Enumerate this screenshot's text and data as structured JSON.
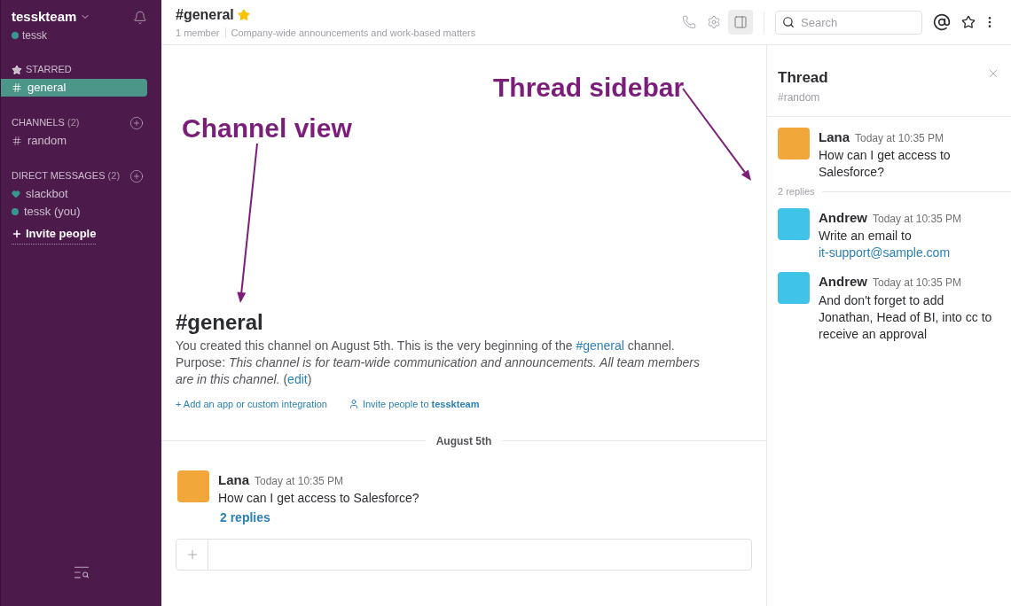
{
  "sidebar": {
    "team": "tesskteam",
    "user": "tessk",
    "starred": {
      "title": "STARRED",
      "items": [
        {
          "kind": "channel",
          "label": "general",
          "selected": true
        }
      ]
    },
    "channels": {
      "title": "CHANNELS",
      "count": "(2)",
      "items": [
        {
          "kind": "channel",
          "label": "random",
          "selected": false
        }
      ]
    },
    "direct_messages": {
      "title": "DIRECT MESSAGES",
      "count": "(2)",
      "items": [
        {
          "kind": "heart",
          "label": "slackbot",
          "selected": false
        },
        {
          "kind": "presence",
          "label": "tessk (you)",
          "selected": false
        }
      ]
    },
    "invite": "Invite people"
  },
  "header": {
    "channel": "#general",
    "starred": true,
    "members": "1 member",
    "topic": "Company-wide announcements and work-based matters",
    "details_toggle": {
      "selected": true
    },
    "search": {
      "placeholder": "Search"
    }
  },
  "channel": {
    "title": "#general",
    "intro_before": "You created this channel on August 5th. This is the very beginning of the ",
    "channel_link": "#general",
    "intro_after": " channel.",
    "purpose": "Purpose: *This channel is for team-wide communication and announcements. All team members are in this channel.* (",
    "edit_link": "edit",
    "purpose_close": ")",
    "add_app": "+ Add an app or custom integration",
    "invite": "Invite people to **tesskteam**",
    "divider": "August 5th",
    "messages": [
      {
        "author": "Lana",
        "color": "#f2a73b",
        "time": "Today at 10:35 PM",
        "text": "How can I get access to Salesforce?",
        "replies": "2 replies"
      }
    ]
  },
  "thread": {
    "title": "Thread",
    "channel": "#random",
    "parent": {
      "author": "Lana",
      "color": "#f2a73b",
      "time": "Today at 10:35 PM",
      "text": "How can I get access to Salesforce?"
    },
    "replies_label": "2 replies",
    "replies": [
      {
        "author": "Andrew",
        "color": "#3fc3e8",
        "time": "Today at 10:35 PM",
        "text": "Write an email to ",
        "link": "it-support@sample.com"
      },
      {
        "author": "Andrew",
        "color": "#3fc3e8",
        "time": "Today at 10:35 PM",
        "text": "And don't forget to add Jonathan, Head of BI, into cc to receive an approval"
      }
    ]
  },
  "annotations": [
    {
      "kind": "channel",
      "text": "Channel view"
    },
    {
      "kind": "thread",
      "text": "Thread sidebar"
    }
  ]
}
